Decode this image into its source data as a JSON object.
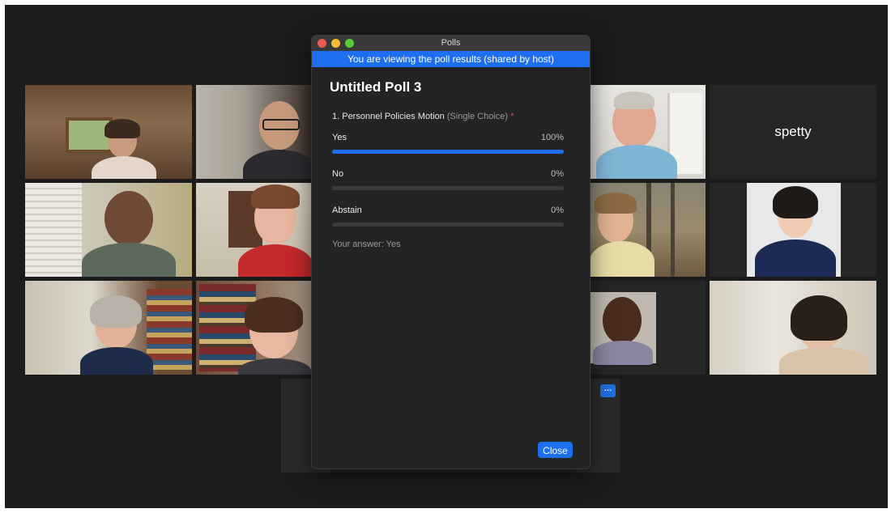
{
  "window": {
    "title": "Polls",
    "banner": "You are viewing the poll results (shared by host)"
  },
  "poll": {
    "title": "Untitled Poll 3",
    "question": {
      "text": "1. Personnel Policies Motion",
      "type": "(Single Choice)",
      "required_mark": "*"
    },
    "options": [
      {
        "label": "Yes",
        "percent_text": "100%",
        "fraction": 1.0
      },
      {
        "label": "No",
        "percent_text": "0%",
        "fraction": 0.0
      },
      {
        "label": "Abstain",
        "percent_text": "0%",
        "fraction": 0.0
      }
    ],
    "your_answer": "Your answer: Yes",
    "close_label": "Close"
  },
  "participants": {
    "name_tile": "spetty",
    "more_button_label": "…"
  },
  "colors": {
    "accent": "#1e6ff0",
    "active_speaker": "#35c44a",
    "required": "#e8484a"
  }
}
